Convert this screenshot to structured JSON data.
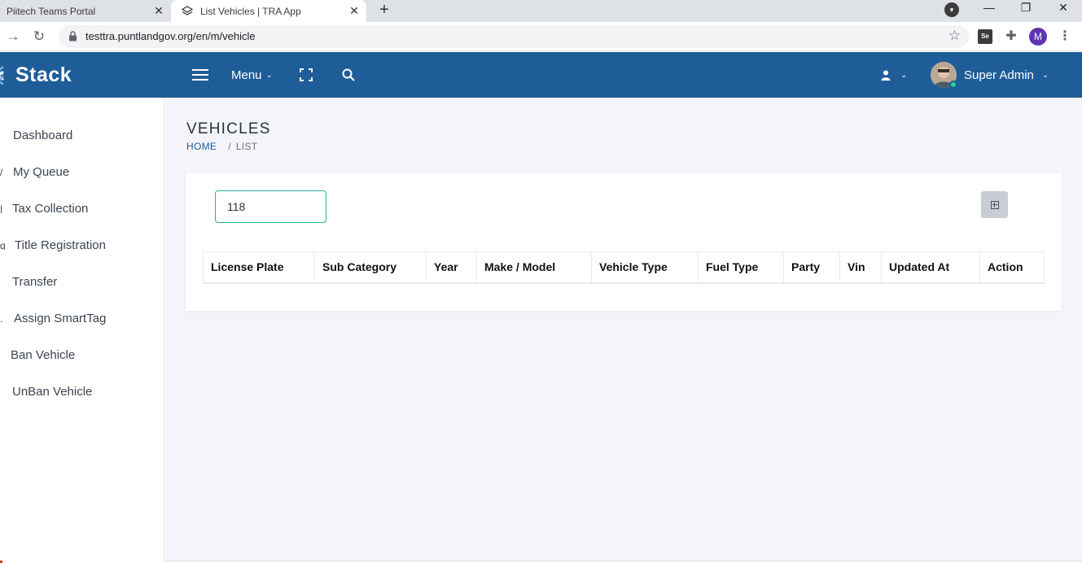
{
  "browser": {
    "tabs": [
      {
        "title": "Piitech Teams Portal",
        "active": false
      },
      {
        "title": "List Vehicles | TRA App",
        "active": true
      }
    ],
    "url": "testtra.puntlandgov.org/en/m/vehicle",
    "profile_initial": "M",
    "extension_label": "Se"
  },
  "header": {
    "brand": "Stack",
    "menu_label": "Menu",
    "user_name": "Super Admin",
    "accent_color": "#1e5d97",
    "online_status_color": "#28d094"
  },
  "sidebar": {
    "items": [
      {
        "label": "Dashboard"
      },
      {
        "label": "My Queue"
      },
      {
        "label": "Tax Collection"
      },
      {
        "label": "Title Registration"
      },
      {
        "label": "Transfer"
      },
      {
        "label": "Assign SmartTag"
      },
      {
        "label": "Ban Vehicle"
      },
      {
        "label": "UnBan Vehicle"
      }
    ]
  },
  "page": {
    "title": "VEHICLES",
    "breadcrumb": {
      "home": "HOME",
      "separator": "/",
      "current": "LIST"
    }
  },
  "filter": {
    "search_value": "118"
  },
  "table": {
    "columns": [
      "License Plate",
      "Sub Category",
      "Year",
      "Make / Model",
      "Vehicle Type",
      "Fuel Type",
      "Party",
      "Vin",
      "Updated At",
      "Action"
    ],
    "rows": []
  }
}
